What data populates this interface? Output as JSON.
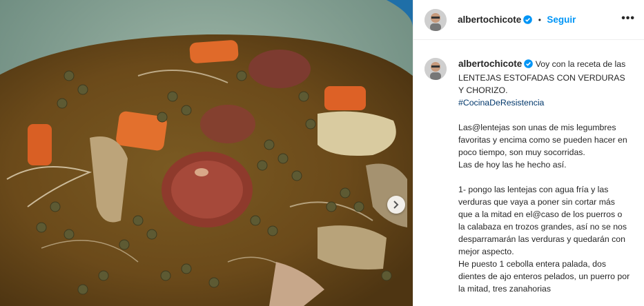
{
  "post": {
    "username": "albertochicote",
    "follow_label": "Seguir",
    "more_icon": "more-horizontal-icon",
    "verified_icon": "verified-badge-icon",
    "next_icon": "chevron-right-icon",
    "caption": {
      "intro": "Voy con la receta de las LENTEJAS ESTOFADAS CON VERDURAS Y CHORIZO.",
      "hashtag": "#CocinaDeResistencia",
      "para1": "Las@lentejas son unas de mis legumbres favoritas y encima como se pueden hacer en poco tiempo, son muy socorridas.\nLas de hoy las he hecho así.",
      "para2": "1- pongo las lentejas con agua fría y las verduras que vaya a poner sin cortar más que a la mitad en el@caso de los puerros o la calabaza en trozos grandes, así no se nos desparramarán las verduras y quedarán con mejor aspecto.\nHe puesto 1 cebolla entera palada, dos dientes de ajo enteros pelados, un puerro por la mitad, tres zanahorias"
    }
  },
  "colors": {
    "follow": "#0095f6",
    "hashtag": "#00376b",
    "verified": "#0095f6",
    "text": "#262626"
  }
}
